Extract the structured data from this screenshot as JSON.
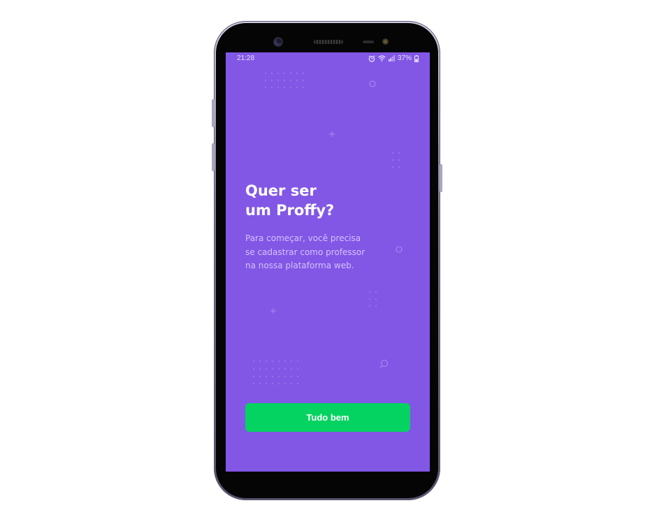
{
  "status_bar": {
    "time": "21:28",
    "battery": "37%",
    "icons": [
      "alarm-icon",
      "wifi-icon",
      "signal-icon",
      "battery-icon"
    ]
  },
  "onboarding": {
    "title_lines": [
      "Quer ser",
      "um Proffy?"
    ],
    "description_lines": [
      "Para começar, você precisa",
      "se cadastrar como professor",
      "na nossa plataforma web."
    ],
    "button_label": "Tudo bem"
  },
  "colors": {
    "background": "#8257e5",
    "button": "#04d361",
    "title": "#ffffff",
    "description": "#d4c2ff"
  }
}
